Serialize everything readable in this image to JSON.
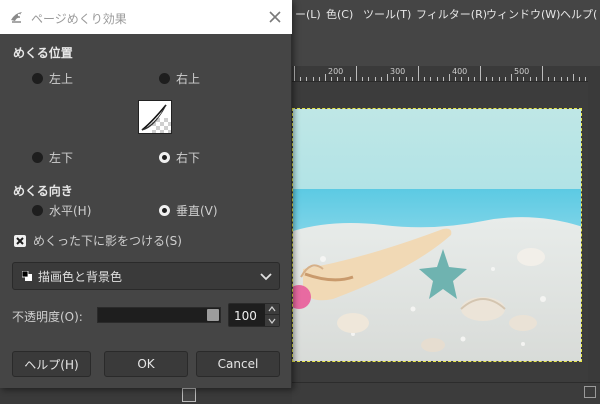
{
  "app": {
    "menubar": [
      "ー(L)",
      "色(C)",
      "ツール(T)",
      "フィルター(R)",
      "ウィンドウ(W)",
      "ヘルプ("
    ],
    "ruler_labels": [
      "200",
      "300",
      "400",
      "500"
    ]
  },
  "dialog": {
    "title": "ページめくり効果",
    "curl_position": {
      "title": "めくる位置",
      "top_left": "左上",
      "top_right": "右上",
      "bottom_left": "左下",
      "bottom_right": "右下",
      "selected": "bottom_right"
    },
    "curl_orientation": {
      "title": "めくる向き",
      "horizontal": "水平(H)",
      "vertical": "垂直(V)",
      "selected": "vertical"
    },
    "shadow": {
      "label": "めくった下に影をつける(S)",
      "checked": true
    },
    "gradient": {
      "value": "描画色と背景色"
    },
    "opacity": {
      "label": "不透明度(O):",
      "value": "100",
      "fraction": 1.0
    },
    "buttons": {
      "help": "ヘルプ(H)",
      "ok": "OK",
      "cancel": "Cancel"
    }
  },
  "colors": {
    "panel": "#454545",
    "titlebar": "#ffffff",
    "selection_marquee": "#e8e84a"
  }
}
